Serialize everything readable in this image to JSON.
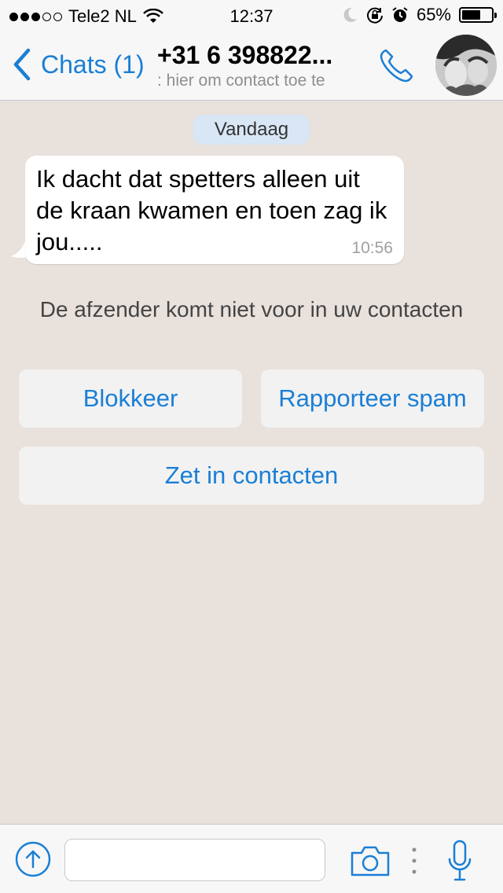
{
  "status_bar": {
    "carrier": "Tele2 NL",
    "time": "12:37",
    "battery_percent": "65%",
    "battery_level": 0.65,
    "signal_bars_filled": 3,
    "signal_bars_total": 5,
    "icons": [
      "signal-dots",
      "wifi-icon",
      "moon-icon",
      "rotation-lock-icon",
      "alarm-icon",
      "battery-icon"
    ]
  },
  "nav_bar": {
    "back_label": "Chats (1)",
    "title": "+31 6 398822...",
    "subtitle": ": hier om contact toe te",
    "icons": [
      "chevron-left-icon",
      "phone-icon",
      "avatar"
    ]
  },
  "chat": {
    "date_label": "Vandaag",
    "message": {
      "text": "Ik dacht dat spetters alleen uit de kraan kwamen en toen zag ik jou.....",
      "time": "10:56"
    },
    "notice": "De afzender komt niet voor in uw contacten",
    "buttons": {
      "block": "Blokkeer",
      "report_spam": "Rapporteer spam",
      "add_contact": "Zet in contacten"
    }
  },
  "input_bar": {
    "placeholder": "",
    "icons": [
      "share-icon",
      "camera-icon",
      "more-icon",
      "microphone-icon"
    ]
  },
  "colors": {
    "accent": "#1a7fd6",
    "chat_background": "#e8e1dc",
    "bar_background": "#f7f7f7",
    "date_pill": "#d8e6f5",
    "button_background": "#f2f2f2"
  }
}
